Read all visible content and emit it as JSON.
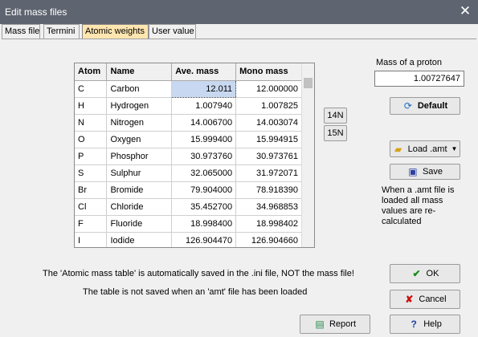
{
  "window": {
    "title": "Edit mass files",
    "close_glyph": "✕"
  },
  "tabs": [
    {
      "label": "Mass file"
    },
    {
      "label": "Termini"
    },
    {
      "label": "Atomic weights"
    },
    {
      "label": "User value"
    }
  ],
  "table": {
    "columns": [
      "Atom",
      "Name",
      "Ave. mass",
      "Mono mass"
    ],
    "rows": [
      {
        "atom": "C",
        "name": "Carbon",
        "ave": "12.011",
        "mono": "12.000000"
      },
      {
        "atom": "H",
        "name": "Hydrogen",
        "ave": "1.007940",
        "mono": "1.007825"
      },
      {
        "atom": "N",
        "name": "Nitrogen",
        "ave": "14.006700",
        "mono": "14.003074"
      },
      {
        "atom": "O",
        "name": "Oxygen",
        "ave": "15.999400",
        "mono": "15.994915"
      },
      {
        "atom": "P",
        "name": "Phosphor",
        "ave": "30.973760",
        "mono": "30.973761"
      },
      {
        "atom": "S",
        "name": "Sulphur",
        "ave": "32.065000",
        "mono": "31.972071"
      },
      {
        "atom": "Br",
        "name": "Bromide",
        "ave": "79.904000",
        "mono": "78.918390"
      },
      {
        "atom": "Cl",
        "name": "Chloride",
        "ave": "35.452700",
        "mono": "34.968853"
      },
      {
        "atom": "F",
        "name": "Fluoride",
        "ave": "18.998400",
        "mono": "18.998402"
      },
      {
        "atom": "I",
        "name": "Iodide",
        "ave": "126.904470",
        "mono": "126.904660"
      }
    ]
  },
  "n_buttons": {
    "n14": "14N",
    "n15": "15N"
  },
  "proton": {
    "label": "Mass of a proton",
    "value": "1.00727647"
  },
  "buttons": {
    "default": "Default",
    "load": "Load .amt",
    "save": "Save",
    "ok": "OK",
    "cancel": "Cancel",
    "report": "Report",
    "help": "Help"
  },
  "notes": {
    "amt": "When a .amt file is loaded all mass values are re-calculated",
    "line1": "The 'Atomic mass table' is automatically saved in the .ini file, NOT the mass file!",
    "line2": "The table is not saved when an 'amt' file has been loaded"
  },
  "icons": {
    "default": "refresh-icon",
    "load": "folder-open-icon",
    "save": "floppy-disk-icon",
    "ok": "checkmark-icon",
    "cancel": "x-mark-icon",
    "report": "report-icon",
    "help": "question-mark-icon"
  },
  "colors": {
    "titlebar": "#5f6570",
    "active_tab": "#ffe6b0",
    "selected_cell": "#c8d8f0",
    "ok_green": "#1a8a1a",
    "cancel_red": "#cc1111",
    "help_blue": "#1a3fa8"
  }
}
